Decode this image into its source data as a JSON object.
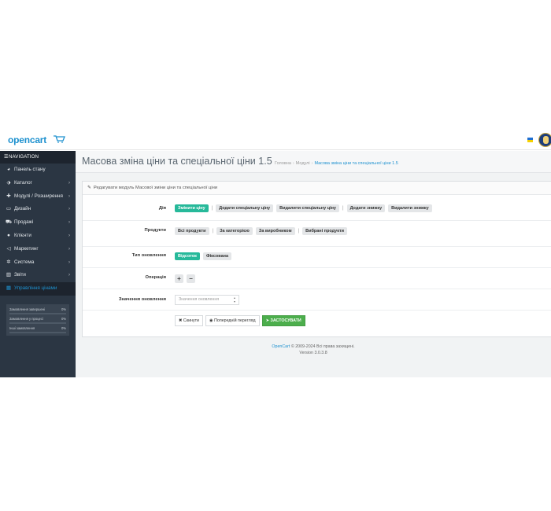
{
  "header": {
    "logo_text": "opencart",
    "language_flag": "ua-flag-icon",
    "avatar": "user-avatar"
  },
  "sidebar": {
    "title": "NAVIGATION",
    "items": [
      {
        "icon": "dashboard-icon",
        "label": "Панель стану",
        "has_arrow": false
      },
      {
        "icon": "tag-icon",
        "label": "Каталог",
        "has_arrow": true
      },
      {
        "icon": "puzzle-icon",
        "label": "Модулі / Розширення",
        "has_arrow": true
      },
      {
        "icon": "monitor-icon",
        "label": "Дизайн",
        "has_arrow": true
      },
      {
        "icon": "cart-icon",
        "label": "Продажі",
        "has_arrow": true
      },
      {
        "icon": "user-icon",
        "label": "Клієнти",
        "has_arrow": true
      },
      {
        "icon": "share-icon",
        "label": "Маркетинг",
        "has_arrow": true
      },
      {
        "icon": "gear-icon",
        "label": "Система",
        "has_arrow": true
      },
      {
        "icon": "bar-chart-icon",
        "label": "Звіти",
        "has_arrow": true
      },
      {
        "icon": "calculator-icon",
        "label": "Управління цінами",
        "has_arrow": false,
        "active": true
      }
    ],
    "stats": [
      {
        "label": "Замовлення завершені",
        "value": "0%",
        "fraction": 0
      },
      {
        "label": "Замовлення у процесі",
        "value": "0%",
        "fraction": 0
      },
      {
        "label": "Інші замовлення",
        "value": "0%",
        "fraction": 0
      }
    ]
  },
  "page": {
    "title": "Масова зміна ціни та спеціальної ціни 1.5",
    "breadcrumbs": [
      "Головна",
      "Модулі",
      "Масова зміна ціни та спеціальної ціни 1.5"
    ]
  },
  "panel": {
    "heading": "Редагувати модуль Масової зміни ціни та спеціальної ціни",
    "action_label": "Дія",
    "actions": [
      "Змінити ціну",
      "Додати спеціальну ціну",
      "Видалити спеціальну ціну",
      "Додати знижку",
      "Видалити знижку"
    ],
    "products_label": "Продукти",
    "products": [
      "Всі продукти",
      "За категорією",
      "За виробником",
      "Вибрані продукти"
    ],
    "update_type_label": "Тип оновлення",
    "update_types": [
      "Відсоток",
      "Фіксована"
    ],
    "operation_label": "Операція",
    "operation_plus": "+",
    "operation_minus": "−",
    "value_label": "Значення оновлення",
    "value_placeholder": "Значення оновлення",
    "reset_label": "Скинути",
    "preview_label": "Попередній перегляд",
    "apply_label": "ЗАСТОСУВАТИ"
  },
  "footer": {
    "link": "OpenCart",
    "rights": "© 2009-2024 Всі права захищені.",
    "version": "Version 3.0.3.8"
  },
  "colors": {
    "accent": "#1e91cf",
    "active_toggle": "#27b99a",
    "apply": "#4cae4c",
    "sidebar_bg": "#2b3643"
  }
}
